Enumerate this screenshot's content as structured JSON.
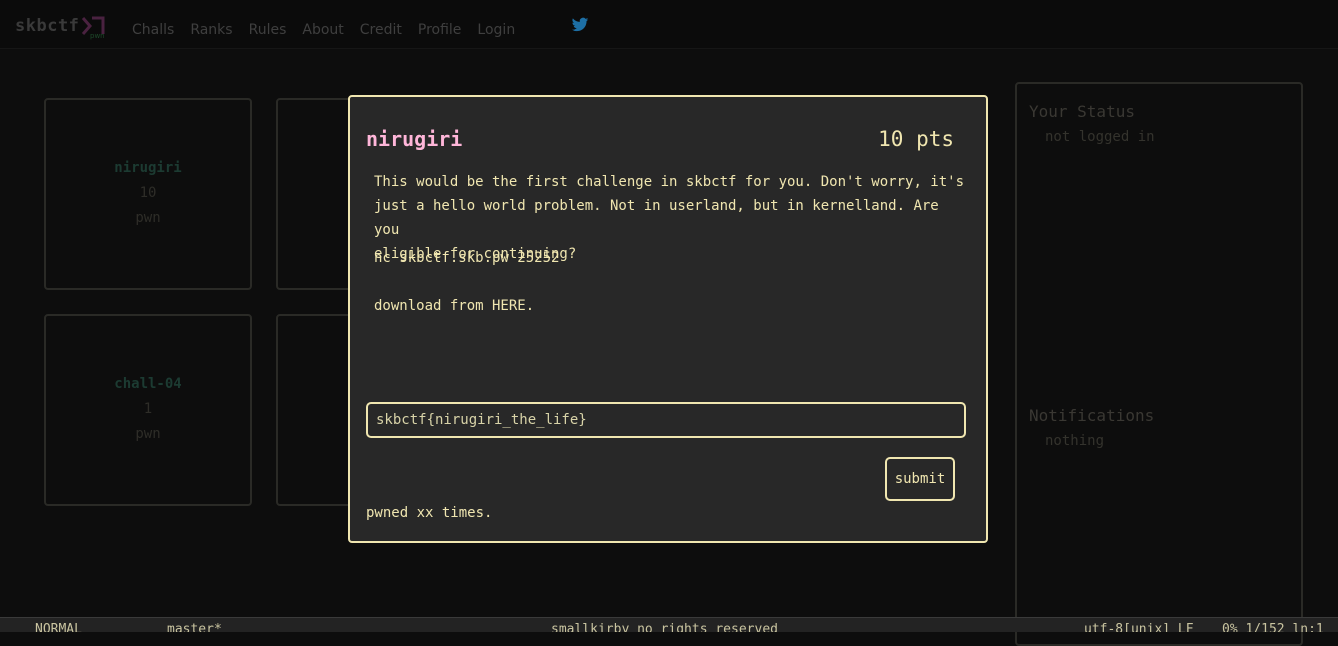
{
  "nav": {
    "brand": "skbctf",
    "logo_tag": "pwn",
    "links": [
      "Challs",
      "Ranks",
      "Rules",
      "About",
      "Credit",
      "Profile"
    ],
    "login": "Login"
  },
  "cards": [
    {
      "name": "nirugiri",
      "points": "10",
      "category": "pwn"
    },
    {
      "name": "chall-04",
      "points": "1",
      "category": "pwn"
    }
  ],
  "sidebar": {
    "status_title": "Your Status",
    "status_text": "not logged in",
    "notifications_title": "Notifications",
    "notifications_text": "nothing"
  },
  "modal": {
    "title": "nirugiri",
    "points": "10 pts",
    "description": "This would be the first challenge in skbctf for you. Don't worry, it's\njust a hello world problem. Not in userland, but in kernelland. Are you\neligible for continuing?",
    "nc": "nc skbctf.skb.pw 25252",
    "download": "download from HERE.",
    "flag_value": "skbctf{nirugiri_the_life}",
    "submit": "submit",
    "pwned": "pwned xx times."
  },
  "statusbar": {
    "mode": "NORMAL",
    "branch": "master*",
    "center": "smallkirby no rights reserved",
    "encoding": "utf-8[unix] LF",
    "position": "0% 1/152 ln:1"
  },
  "colors": {
    "accent": "#f0e6b0",
    "title_pink": "#ffb6d9",
    "modal_bg": "#282828",
    "page_bg": "#0d0d0d"
  }
}
